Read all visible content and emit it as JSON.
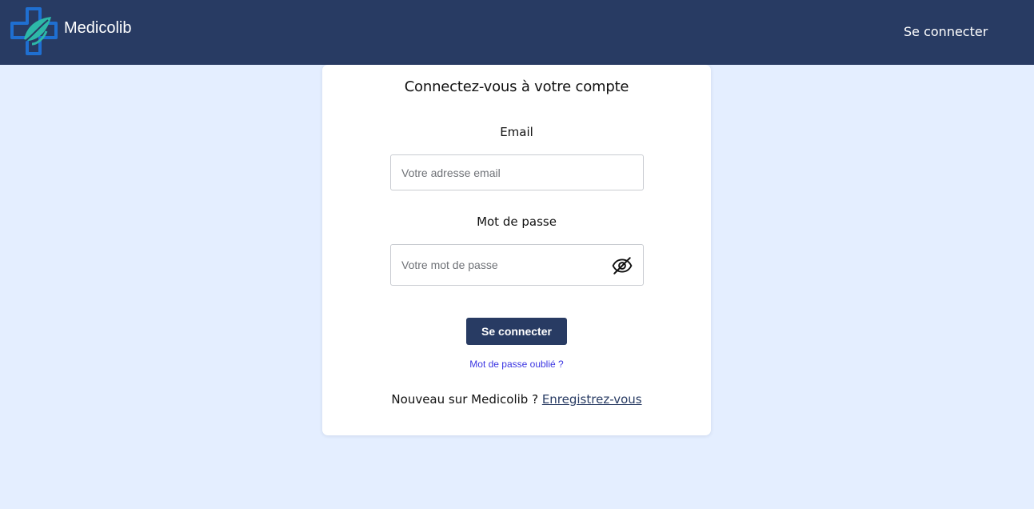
{
  "navbar": {
    "brand_name": "Medicolib",
    "login_link": "Se connecter",
    "logo_icon": "medical-cross-leaf-icon"
  },
  "login_card": {
    "title": "Connectez-vous à votre compte",
    "email_label": "Email",
    "email_placeholder": "Votre adresse email",
    "email_value": "",
    "password_label": "Mot de passe",
    "password_placeholder": "Votre mot de passe",
    "password_value": "",
    "password_toggle_icon": "eye-slash-icon",
    "submit_label": "Se connecter",
    "forgot_password": "Mot de passe oublié ?",
    "signup_prompt": "Nouveau sur Medicolib ?",
    "signup_link": "Enregistrez-vous"
  },
  "colors": {
    "navbar": "#283b63",
    "page_background": "#e4eeff",
    "primary_button": "#283b63",
    "link": "#3b35e2"
  }
}
